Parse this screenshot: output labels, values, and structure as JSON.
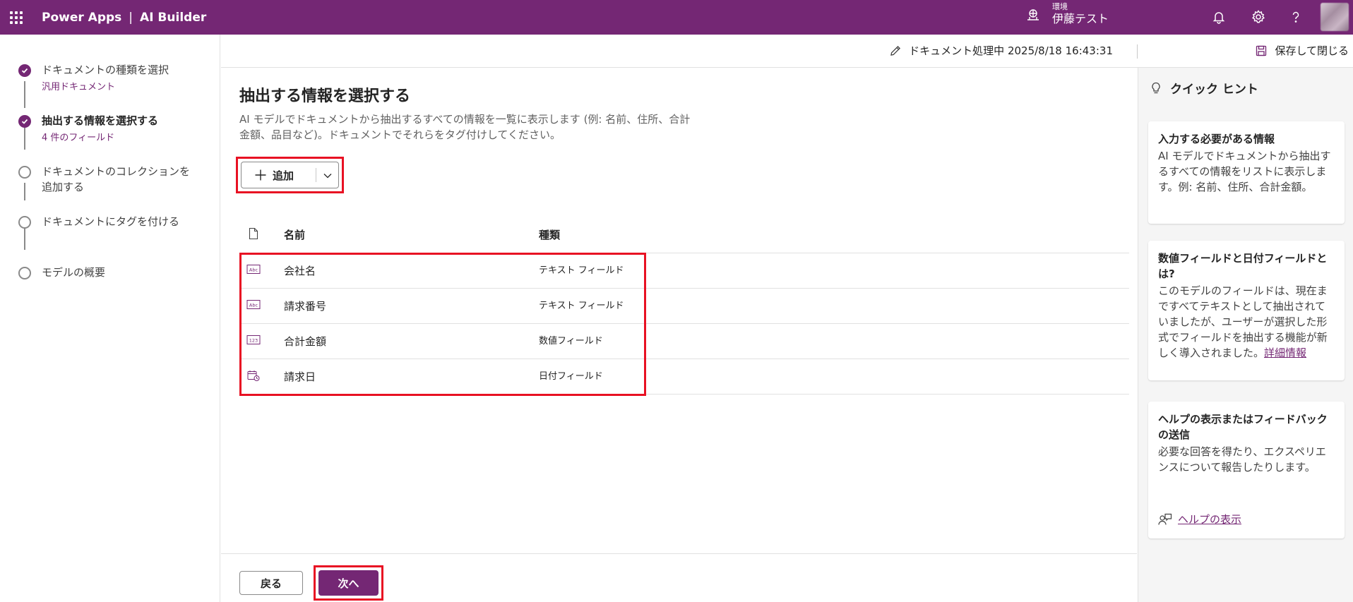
{
  "header": {
    "app_name": "Power Apps",
    "separator": "|",
    "product": "AI Builder",
    "env_label": "環境",
    "env_name": "伊藤テスト"
  },
  "commandbar": {
    "status": "ドキュメント処理中 2025/8/18 16:43:31",
    "save_close": "保存して閉じる"
  },
  "steps": [
    {
      "title": "ドキュメントの種類を選択",
      "sub": "汎用ドキュメント",
      "state": "done"
    },
    {
      "title": "抽出する情報を選択する",
      "sub": "4 件のフィールド",
      "state": "current"
    },
    {
      "title": "ドキュメントのコレクションを",
      "title2": "追加する",
      "state": "todo"
    },
    {
      "title": "ドキュメントにタグを付ける",
      "state": "todo"
    },
    {
      "title": "モデルの概要",
      "state": "todo"
    }
  ],
  "main": {
    "title": "抽出する情報を選択する",
    "desc_line1": "AI モデルでドキュメントから抽出するすべての情報を一覧に表示します (例: 名前、住所、合計",
    "desc_line2": "金額、品目など)。ドキュメントでそれらをタグ付けしてください。",
    "add_label": "追加",
    "table": {
      "col_name": "名前",
      "col_type": "種類",
      "rows": [
        {
          "icon": "text-field-icon",
          "name": "会社名",
          "type": "テキスト フィールド"
        },
        {
          "icon": "text-field-icon",
          "name": "請求番号",
          "type": "テキスト フィールド"
        },
        {
          "icon": "number-field-icon",
          "name": "合計金額",
          "type": "数値フィールド"
        },
        {
          "icon": "date-field-icon",
          "name": "請求日",
          "type": "日付フィールド"
        }
      ]
    }
  },
  "footer": {
    "back": "戻る",
    "next": "次へ"
  },
  "hints": {
    "title": "クイック ヒント",
    "cards": [
      {
        "title": "入力する必要がある情報",
        "body": "AI モデルでドキュメントから抽出するすべての情報をリストに表示します。例: 名前、住所、合計金額。"
      },
      {
        "title": "数値フィールドと日付フィールドとは?",
        "body": "このモデルのフィールドは、現在まですべてテキストとして抽出されていましたが、ユーザーが選択した形式でフィールドを抽出する機能が新しく導入されました。",
        "link": "詳細情報"
      },
      {
        "title": "ヘルプの表示またはフィードバックの送信",
        "body": "必要な回答を得たり、エクスペリエンスについて報告したりします。"
      }
    ],
    "help_link": "ヘルプの表示"
  },
  "colors": {
    "brand": "#742774",
    "highlight": "#e81123"
  }
}
